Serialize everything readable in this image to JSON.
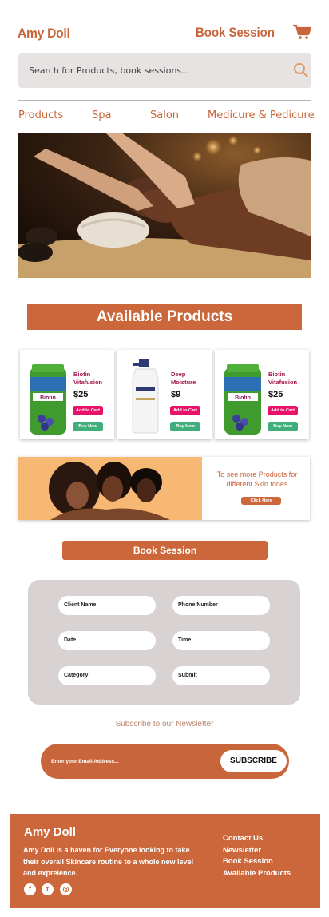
{
  "header": {
    "brand": "Amy Doll",
    "book_session": "Book Session",
    "cart_icon": "cart-icon"
  },
  "search": {
    "placeholder": "Search for Products, book sessions...",
    "icon": "search-icon"
  },
  "nav": {
    "items": [
      {
        "label": "Products"
      },
      {
        "label": "Spa"
      },
      {
        "label": "Salon"
      },
      {
        "label": "Medicure & Pedicure"
      }
    ]
  },
  "hero": {
    "image": "massage-photo"
  },
  "products": {
    "title": "Available Products",
    "items": [
      {
        "name": "Biotin Vitafusion",
        "price": "$25",
        "add_label": "Add to Cart",
        "buy_label": "Buy Now"
      },
      {
        "name": "Deep Moisture",
        "price": "$9",
        "add_label": "Add to Cart",
        "buy_label": "Buy Now"
      },
      {
        "name": "Biotin Vitafusion",
        "price": "$25",
        "add_label": "Add to Cart",
        "buy_label": "Buy Now"
      }
    ],
    "bottle_label": "Biotin"
  },
  "banner": {
    "text": "To see more Products for different Skin tones",
    "button": "Click Here"
  },
  "booking": {
    "title": "Book Session",
    "fields": [
      {
        "label": "Client Name"
      },
      {
        "label": "Phone Number"
      },
      {
        "label": "Date"
      },
      {
        "label": "Time"
      },
      {
        "label": "Category"
      },
      {
        "label": "Submit"
      }
    ]
  },
  "newsletter": {
    "title": "Subscribe to our Newsletter",
    "placeholder": "Enter your Email Address...",
    "button": "SUBSCRIBE"
  },
  "footer": {
    "brand": "Amy Doll",
    "description": "Amy Doll is a haven for Everyone looking to take their overall Skincare routine to a whole new level and expreience.",
    "social": [
      {
        "icon": "facebook-icon",
        "glyph": "f"
      },
      {
        "icon": "twitter-icon",
        "glyph": "t"
      },
      {
        "icon": "instagram-icon",
        "glyph": "◎"
      }
    ],
    "links": [
      {
        "label": "Contact Us"
      },
      {
        "label": "Newsletter"
      },
      {
        "label": "Book Session"
      },
      {
        "label": "Available Products"
      }
    ]
  },
  "colors": {
    "accent": "#cb673b",
    "search_bg": "#e7e3e2",
    "form_bg": "#d8d3d2",
    "add_to_cart": "#e8126a",
    "buy_now": "#3fae7a",
    "product_name": "#a3124a"
  }
}
